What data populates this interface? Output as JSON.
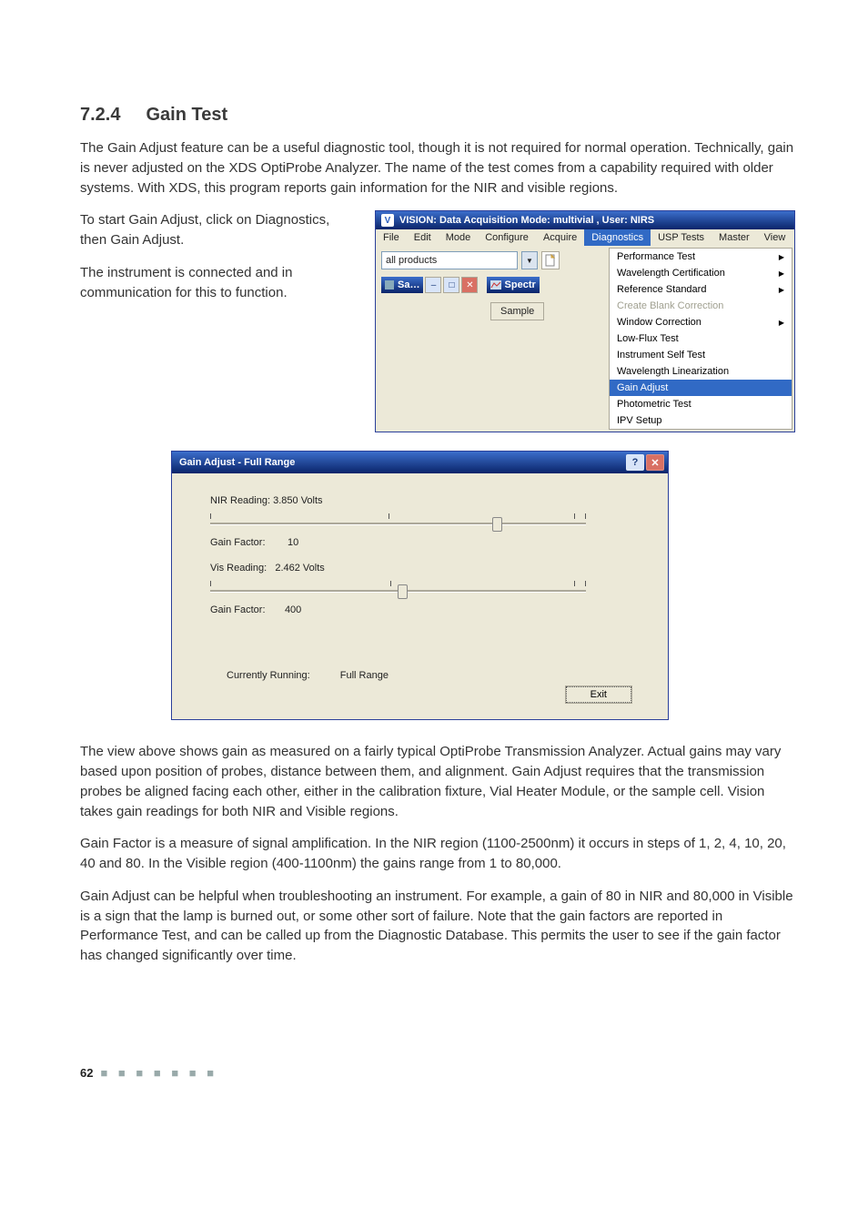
{
  "section": {
    "number": "7.2.4",
    "title": "Gain Test"
  },
  "paragraphs": {
    "p1": "The Gain Adjust feature can be a useful diagnostic tool, though it is not required for normal operation. Technically, gain is never adjusted on the XDS OptiProbe Analyzer. The name of the test comes from a capability required with older systems. With XDS, this program reports gain information for the NIR and visible regions.",
    "p2a": "To start Gain Adjust, click on Diagnostics, then Gain Adjust.",
    "p2b": "The instrument is connected and in communication for this to function.",
    "p3": "The view above shows gain as measured on a fairly typical OptiProbe Transmission Analyzer. Actual gains may vary based upon position of probes, distance between them, and alignment. Gain Adjust requires that the transmission probes be aligned facing each other, either in the calibration fixture, Vial Heater Module, or the sample cell. Vision takes gain readings for both NIR and Visible regions.",
    "p4": "Gain Factor is a measure of signal amplification. In the NIR region (1100-2500nm) it occurs in steps of 1, 2, 4, 10, 20, 40 and 80. In the Visible region (400-1100nm) the gains range from 1 to 80,000.",
    "p5": "Gain Adjust can be helpful when troubleshooting an instrument. For example, a gain of 80 in NIR and 80,000 in Visible is a sign that the lamp is burned out, or some other sort of failure. Note that the gain factors are reported in Performance Test, and can be called up from the Diagnostic Database. This permits the user to see if the gain factor has changed significantly over time."
  },
  "vision": {
    "title": "VISION: Data Acquisition Mode: multivial , User: NIRS",
    "menu": [
      "File",
      "Edit",
      "Mode",
      "Configure",
      "Acquire",
      "Diagnostics",
      "USP Tests",
      "Master",
      "View"
    ],
    "active_menu": "Diagnostics",
    "combo_value": "all products",
    "subwin_label": "Sa…",
    "spectr_label": "Spectr",
    "sample_btn": "Sample",
    "diag_items": [
      {
        "label": "Performance Test",
        "arrow": true
      },
      {
        "label": "Wavelength Certification",
        "arrow": true
      },
      {
        "label": "Reference Standard",
        "arrow": true
      },
      {
        "label": "Create Blank Correction",
        "arrow": false,
        "disabled": true
      },
      {
        "label": "Window Correction",
        "arrow": true
      },
      {
        "label": "Low-Flux Test",
        "arrow": false
      },
      {
        "label": "Instrument Self Test",
        "arrow": false
      },
      {
        "label": "Wavelength Linearization",
        "arrow": false
      },
      {
        "label": "Gain Adjust",
        "arrow": false,
        "active": true
      },
      {
        "label": "Photometric Test",
        "arrow": false
      },
      {
        "label": "IPV Setup",
        "arrow": false
      }
    ]
  },
  "gain": {
    "title": "Gain Adjust - Full Range",
    "nir_reading_label": "NIR Reading:",
    "nir_reading_value": "3.850 Volts",
    "vis_reading_label": "Vis Reading:",
    "vis_reading_value": "2.462 Volts",
    "gain_factor_label": "Gain Factor:",
    "nir_gain_factor": "10",
    "vis_gain_factor": "400",
    "running_label": "Currently Running:",
    "running_value": "Full Range",
    "exit_btn": "Exit"
  },
  "footer": {
    "page": "62"
  }
}
